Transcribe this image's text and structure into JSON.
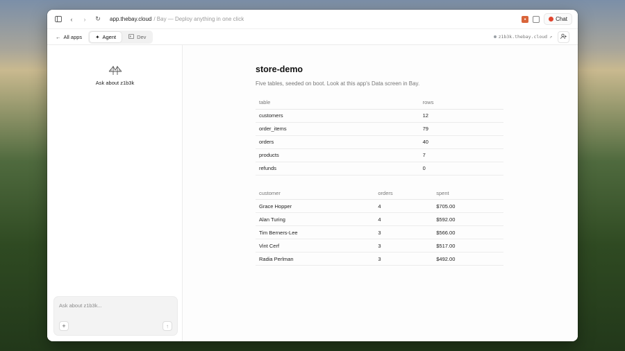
{
  "browser": {
    "host": "app.thebay.cloud",
    "rest": "/ Bay — Deploy anything in one click",
    "chat_label": "Chat"
  },
  "toolbar": {
    "back_label": "All apps",
    "tabs": [
      {
        "label": "Agent",
        "active": true
      },
      {
        "label": "Dev",
        "active": false
      }
    ],
    "domain": "z1b3k.thebay.cloud"
  },
  "sidebar": {
    "empty_label": "Ask about z1b3k",
    "composer_placeholder": "Ask about z1b3k..."
  },
  "page": {
    "title": "store-demo",
    "subtitle": "Five tables, seeded on boot. Look at this app's Data screen in Bay."
  },
  "tables_table": {
    "headers": [
      "table",
      "rows"
    ],
    "rows": [
      [
        "customers",
        "12"
      ],
      [
        "order_items",
        "79"
      ],
      [
        "orders",
        "40"
      ],
      [
        "products",
        "7"
      ],
      [
        "refunds",
        "0"
      ]
    ]
  },
  "customers_table": {
    "headers": [
      "customer",
      "orders",
      "spent"
    ],
    "rows": [
      [
        "Grace Hopper",
        "4",
        "$705.00"
      ],
      [
        "Alan Turing",
        "4",
        "$592.00"
      ],
      [
        "Tim Berners-Lee",
        "3",
        "$566.00"
      ],
      [
        "Vint Cerf",
        "3",
        "$517.00"
      ],
      [
        "Radia Perlman",
        "3",
        "$492.00"
      ]
    ]
  },
  "colors": {
    "chat_accent": "#e0442e",
    "extension_accent": "#d9653b"
  }
}
